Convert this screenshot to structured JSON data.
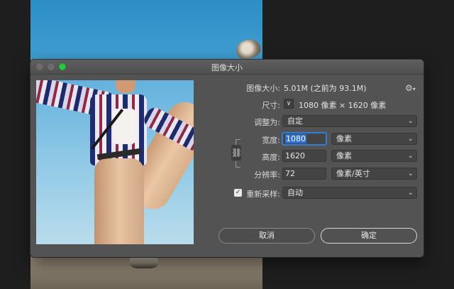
{
  "dialog": {
    "title": "图像大小"
  },
  "info": {
    "image_size_label": "图像大小:",
    "image_size_value": "5.01M (之前为 93.1M)",
    "dimensions_label": "尺寸:",
    "dimensions_value": "1080 像素  ×  1620 像素"
  },
  "fit_to": {
    "label": "调整为:",
    "value": "自定"
  },
  "width": {
    "label": "宽度:",
    "value": "1080",
    "unit": "像素"
  },
  "height": {
    "label": "高度:",
    "value": "1620",
    "unit": "像素"
  },
  "resolution": {
    "label": "分辨率:",
    "value": "72",
    "unit": "像素/英寸"
  },
  "resample": {
    "label": "重新采样:",
    "checked": true,
    "value": "自动"
  },
  "buttons": {
    "cancel": "取消",
    "ok": "确定"
  },
  "icons": {
    "gear": "gear-icon",
    "chevron": "chevron-down-icon",
    "link": "link-icon"
  }
}
